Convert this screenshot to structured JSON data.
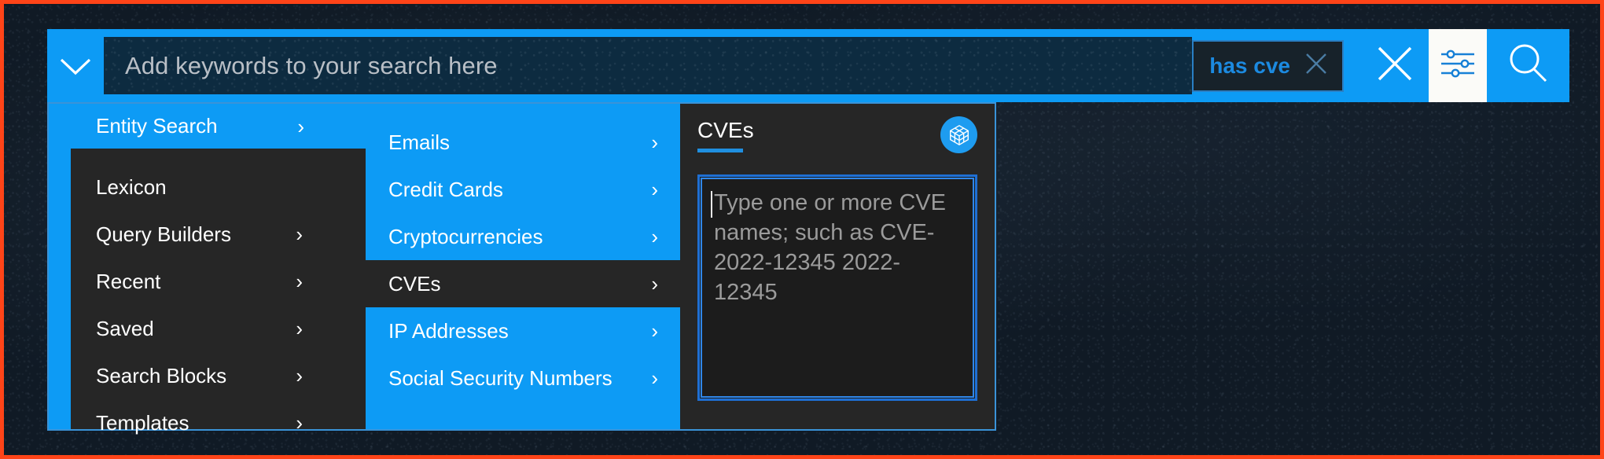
{
  "theme": {
    "accent_blue": "#0d9bf5",
    "panel_dark": "#262626",
    "page_bg": "#101a25",
    "annotation_border": "#ff4418",
    "chip_text": "#1c8ae0"
  },
  "search_bar": {
    "expand_icon": "chevron-down-icon",
    "input_placeholder": "Add keywords to your search here",
    "input_value": "",
    "chip": {
      "label": "has cve",
      "remove_icon": "close-icon"
    },
    "clear_all_icon": "close-icon",
    "filter_icon": "sliders-filter-icon",
    "search_icon": "search-icon"
  },
  "dropdown": {
    "column1": {
      "root": {
        "label": "Entity Search",
        "chevron": "›",
        "active": true
      },
      "items": [
        {
          "label": "Lexicon",
          "chevron": ""
        },
        {
          "label": "Query Builders",
          "chevron": "›"
        },
        {
          "label": "Recent",
          "chevron": "›"
        },
        {
          "label": "Saved",
          "chevron": "›"
        },
        {
          "label": "Search Blocks",
          "chevron": "›"
        },
        {
          "label": "Templates",
          "chevron": "›"
        }
      ]
    },
    "column2": {
      "items": [
        {
          "label": "Emails",
          "chevron": "›",
          "selected": false
        },
        {
          "label": "Credit Cards",
          "chevron": "›",
          "selected": false
        },
        {
          "label": "Cryptocurrencies",
          "chevron": "›",
          "selected": false
        },
        {
          "label": "CVEs",
          "chevron": "›",
          "selected": true
        },
        {
          "label": "IP Addresses",
          "chevron": "›",
          "selected": false
        },
        {
          "label": "Social Security Numbers",
          "chevron": "›",
          "selected": false
        }
      ]
    },
    "column3": {
      "title": "CVEs",
      "entity_icon": "cube-blocks-icon",
      "textarea_placeholder": "Type one or more CVE names; such as CVE-2022-12345 2022-12345",
      "textarea_value": ""
    }
  }
}
